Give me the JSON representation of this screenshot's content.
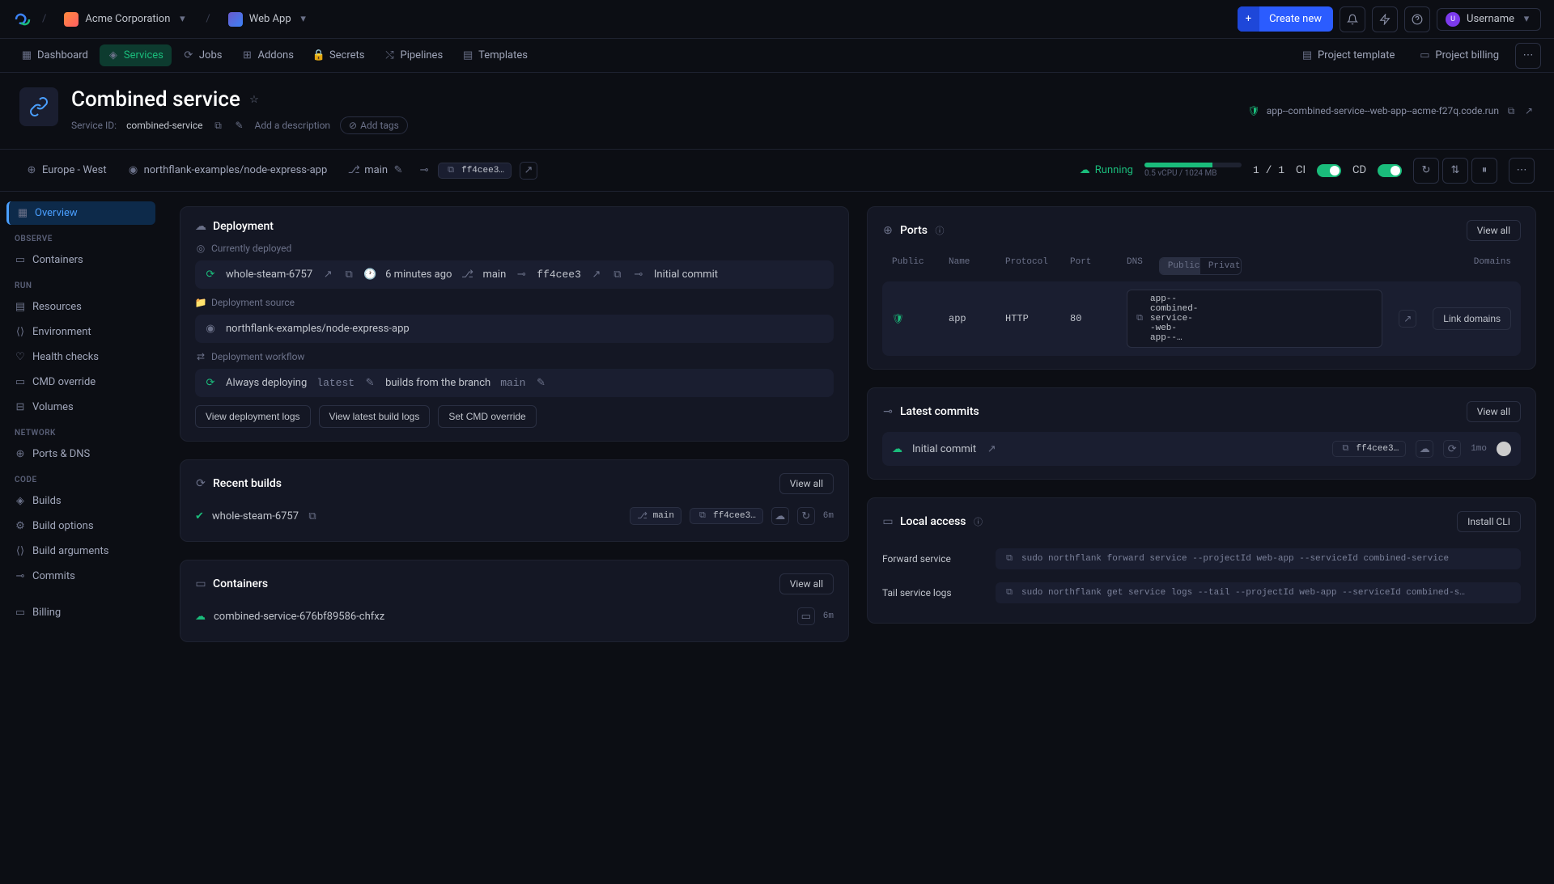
{
  "topbar": {
    "org": "Acme Corporation",
    "app": "Web App",
    "create": "Create new",
    "username": "Username",
    "user_initial": "U"
  },
  "subnav": {
    "items": [
      "Dashboard",
      "Services",
      "Jobs",
      "Addons",
      "Secrets",
      "Pipelines",
      "Templates"
    ],
    "project_template": "Project template",
    "project_billing": "Project billing"
  },
  "header": {
    "title": "Combined service",
    "service_id_label": "Service ID:",
    "service_id": "combined-service",
    "desc_placeholder": "Add a description",
    "tags_placeholder": "Add tags",
    "domain": "app--combined-service--web-app--acme-f27q.code.run"
  },
  "statusbar": {
    "region": "Europe - West",
    "repo": "northflank-examples/node-express-app",
    "branch": "main",
    "hash": "ff4cee3…",
    "status": "Running",
    "resources": "0.5 vCPU / 1024 MB",
    "instances": "1 / 1",
    "ci": "CI",
    "cd": "CD"
  },
  "sidebar": {
    "overview": "Overview",
    "head1": "Observe",
    "containers": "Containers",
    "head2": "Run",
    "resources": "Resources",
    "environment": "Environment",
    "health": "Health checks",
    "cmd": "CMD override",
    "volumes": "Volumes",
    "head3": "Network",
    "ports": "Ports & DNS",
    "head4": "Code",
    "builds": "Builds",
    "buildopts": "Build options",
    "buildargs": "Build arguments",
    "commits": "Commits",
    "billing": "Billing"
  },
  "deployment": {
    "title": "Deployment",
    "currently": "Currently deployed",
    "build_name": "whole-steam-6757",
    "time_ago": "6 minutes ago",
    "branch": "main",
    "hash": "ff4cee3",
    "commit_msg": "Initial commit",
    "source_label": "Deployment source",
    "source": "northflank-examples/node-express-app",
    "workflow_label": "Deployment workflow",
    "workflow_pre": "Always deploying",
    "workflow_latest": "latest",
    "workflow_mid": "builds from the branch",
    "workflow_branch": "main",
    "btn1": "View deployment logs",
    "btn2": "View latest build logs",
    "btn3": "Set CMD override"
  },
  "builds": {
    "title": "Recent builds",
    "viewall": "View all",
    "name": "whole-steam-6757",
    "branch": "main",
    "hash": "ff4cee3…",
    "time": "6m"
  },
  "containers": {
    "title": "Containers",
    "viewall": "View all",
    "name": "combined-service-676bf89586-chfxz",
    "time": "6m"
  },
  "ports": {
    "title": "Ports",
    "viewall": "View all",
    "th_public": "Public",
    "th_name": "Name",
    "th_proto": "Protocol",
    "th_port": "Port",
    "th_dns": "DNS",
    "pill_public": "Public",
    "pill_private": "Private",
    "th_domains": "Domains",
    "row_name": "app",
    "row_proto": "HTTP",
    "row_port": "80",
    "row_dns": "app--combined-service--web-app--…",
    "link_domains": "Link domains"
  },
  "commits": {
    "title": "Latest commits",
    "viewall": "View all",
    "msg": "Initial commit",
    "hash": "ff4cee3…",
    "time": "1mo"
  },
  "local": {
    "title": "Local access",
    "install": "Install CLI",
    "forward_label": "Forward service",
    "forward_cmd": "sudo northflank forward service --projectId web-app --serviceId combined-service",
    "tail_label": "Tail service logs",
    "tail_cmd": "sudo northflank get service logs --tail --projectId web-app --serviceId combined-s…"
  }
}
